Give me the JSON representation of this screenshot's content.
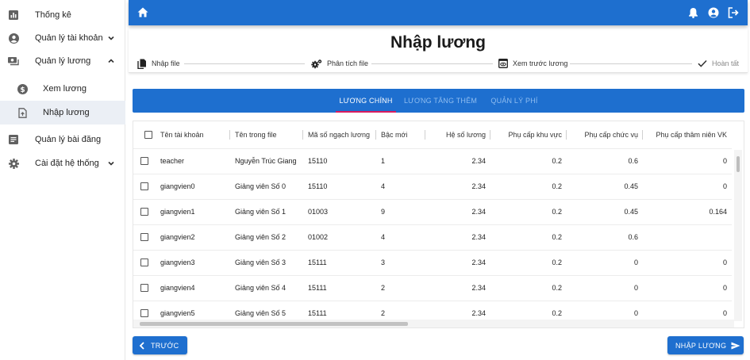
{
  "sidebar": {
    "items": [
      {
        "label": "Thống kê",
        "icon": "bar-chart-icon"
      },
      {
        "label": "Quản lý tài khoản",
        "icon": "account-circle-icon",
        "expanded": false
      },
      {
        "label": "Quản lý lương",
        "icon": "payments-icon",
        "expanded": true
      },
      {
        "label": "Xem lương",
        "icon": "dollar-circle-icon"
      },
      {
        "label": "Nhập lương",
        "icon": "file-upload-icon",
        "active": true
      },
      {
        "label": "Quản lý bài đăng",
        "icon": "article-icon"
      },
      {
        "label": "Cài đặt hệ thống",
        "icon": "gear-icon",
        "expanded": false
      }
    ]
  },
  "appbar": {
    "icons": [
      "home-icon",
      "bell-icon",
      "account-icon",
      "logout-icon"
    ],
    "color": "#1e6fcf"
  },
  "header": {
    "title": "Nhập lương",
    "steps": [
      {
        "label": "Nhập file",
        "icon": "file-copy-icon"
      },
      {
        "label": "Phân tích file",
        "icon": "gears-icon"
      },
      {
        "label": "Xem trước lương",
        "icon": "preview-icon"
      },
      {
        "label": "Hoàn tất",
        "icon": "check-icon"
      }
    ]
  },
  "tabs": [
    {
      "label": "LƯƠNG CHÍNH",
      "active": true
    },
    {
      "label": "LƯƠNG TĂNG THÊM",
      "active": false
    },
    {
      "label": "QUẢN LÝ PHÍ",
      "active": false
    }
  ],
  "table": {
    "columns": [
      "Tên tài khoản",
      "Tên trong file",
      "Mã số ngạch lương",
      "Bậc mới",
      "Hệ số lương",
      "Phụ cấp khu vực",
      "Phụ cấp chức vụ",
      "Phụ cấp thâm niên VK"
    ],
    "rows": [
      [
        "teacher",
        "Nguyễn Trúc Giang",
        "15110",
        "1",
        "2.34",
        "0.2",
        "0.6",
        "0"
      ],
      [
        "giangvien0",
        "Giảng viên Số 0",
        "15110",
        "4",
        "2.34",
        "0.2",
        "0.45",
        "0"
      ],
      [
        "giangvien1",
        "Giảng viên Số 1",
        "01003",
        "9",
        "2.34",
        "0.2",
        "0.45",
        "0.164"
      ],
      [
        "giangvien2",
        "Giảng viên Số 2",
        "01002",
        "4",
        "2.34",
        "0.2",
        "0.6",
        ""
      ],
      [
        "giangvien3",
        "Giảng viên Số 3",
        "15111",
        "3",
        "2.34",
        "0.2",
        "0",
        "0"
      ],
      [
        "giangvien4",
        "Giảng viên Số 4",
        "15111",
        "2",
        "2.34",
        "0.2",
        "0",
        "0"
      ],
      [
        "giangvien5",
        "Giảng viên Số 5",
        "15111",
        "2",
        "2.34",
        "0.2",
        "0",
        "0"
      ]
    ]
  },
  "footer": {
    "prev_label": "TRƯỚC",
    "next_label": "NHẬP LƯƠNG"
  }
}
